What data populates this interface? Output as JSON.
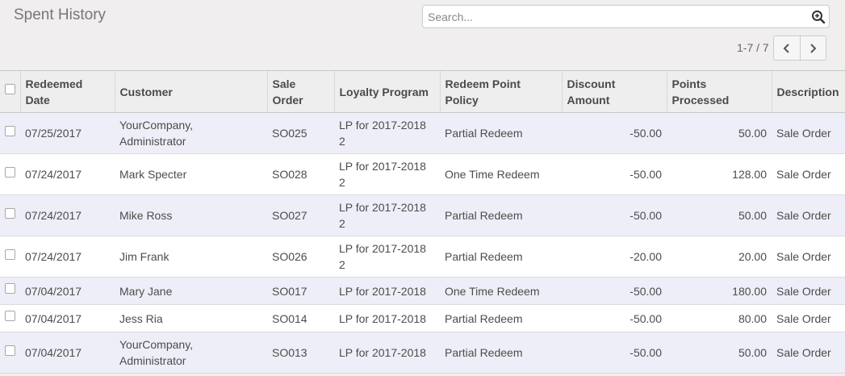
{
  "page": {
    "title": "Spent History"
  },
  "search": {
    "placeholder": "Search...",
    "value": ""
  },
  "pager": {
    "value": "1-7 / 7"
  },
  "table": {
    "headers": {
      "redeemed_date": [
        "Redeemed",
        "Date"
      ],
      "customer": "Customer",
      "sale_order": [
        "Sale",
        "Order"
      ],
      "loyalty_program": "Loyalty Program",
      "redeem_point_policy": [
        "Redeem Point",
        "Policy"
      ],
      "discount_amount": [
        "Discount",
        "Amount"
      ],
      "points_processed": [
        "Points",
        "Processed"
      ],
      "description": "Description"
    },
    "rows": [
      {
        "date": "07/25/2017",
        "customer": [
          "YourCompany,",
          "Administrator"
        ],
        "order": "SO025",
        "program": [
          "LP for 2017-2018",
          "2"
        ],
        "policy": "Partial Redeem",
        "discount": "-50.00",
        "points": "50.00",
        "description": "Sale Order"
      },
      {
        "date": "07/24/2017",
        "customer": [
          "Mark Specter",
          ""
        ],
        "order": "SO028",
        "program": [
          "LP for 2017-2018",
          "2"
        ],
        "policy": "One Time Redeem",
        "discount": "-50.00",
        "points": "128.00",
        "description": "Sale Order"
      },
      {
        "date": "07/24/2017",
        "customer": [
          "Mike Ross",
          ""
        ],
        "order": "SO027",
        "program": [
          "LP for 2017-2018",
          "2"
        ],
        "policy": "Partial Redeem",
        "discount": "-50.00",
        "points": "50.00",
        "description": "Sale Order"
      },
      {
        "date": "07/24/2017",
        "customer": [
          "Jim Frank",
          ""
        ],
        "order": "SO026",
        "program": [
          "LP for 2017-2018",
          "2"
        ],
        "policy": "Partial Redeem",
        "discount": "-20.00",
        "points": "20.00",
        "description": "Sale Order"
      },
      {
        "date": "07/04/2017",
        "customer": [
          "Mary Jane",
          ""
        ],
        "order": "SO017",
        "program": [
          "LP for 2017-2018",
          ""
        ],
        "policy": "One Time Redeem",
        "discount": "-50.00",
        "points": "180.00",
        "description": "Sale Order"
      },
      {
        "date": "07/04/2017",
        "customer": [
          "Jess Ria",
          ""
        ],
        "order": "SO014",
        "program": [
          "LP for 2017-2018",
          ""
        ],
        "policy": "Partial Redeem",
        "discount": "-50.00",
        "points": "80.00",
        "description": "Sale Order"
      },
      {
        "date": "07/04/2017",
        "customer": [
          "YourCompany,",
          "Administrator"
        ],
        "order": "SO013",
        "program": [
          "LP for 2017-2018",
          ""
        ],
        "policy": "Partial Redeem",
        "discount": "-50.00",
        "points": "50.00",
        "description": "Sale Order"
      }
    ]
  },
  "icons": {
    "search": "magnifier-plus-icon",
    "prev": "chevron-left-icon",
    "next": "chevron-right-icon"
  }
}
